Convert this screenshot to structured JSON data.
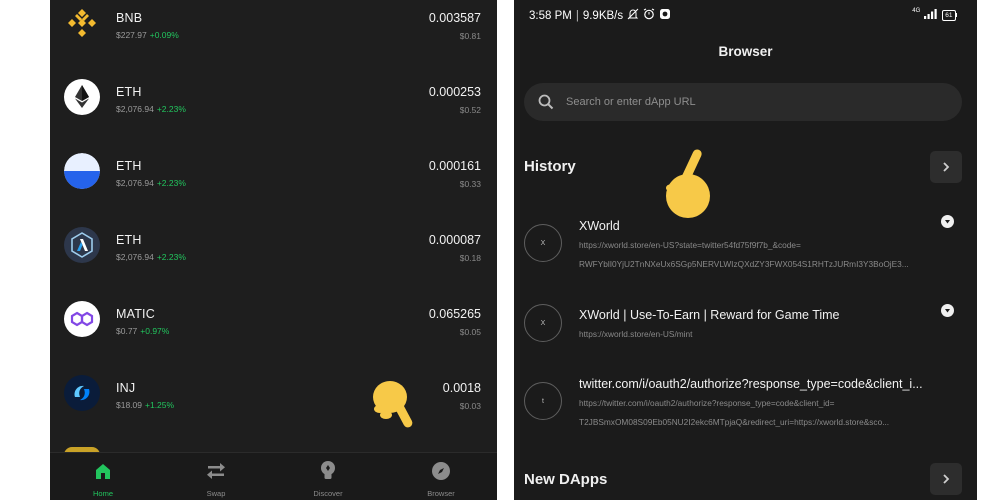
{
  "wallet": {
    "tokens": [
      {
        "symbol": "BNB",
        "price": "$227.97",
        "change": "+0.09%",
        "amount": "0.003587",
        "usd": "$0.81",
        "icon": "bnb-icon",
        "color": "#f3ba2f"
      },
      {
        "symbol": "ETH",
        "price": "$2,076.94",
        "change": "+2.23%",
        "amount": "0.000253",
        "usd": "$0.52",
        "icon": "ethereum-icon",
        "color": "#ffffff"
      },
      {
        "symbol": "ETH",
        "price": "$2,076.94",
        "change": "+2.23%",
        "amount": "0.000161",
        "usd": "$0.33",
        "icon": "base-icon",
        "color": "#2563eb"
      },
      {
        "symbol": "ETH",
        "price": "$2,076.94",
        "change": "+2.23%",
        "amount": "0.000087",
        "usd": "$0.18",
        "icon": "arbitrum-icon",
        "color": "#2d374b"
      },
      {
        "symbol": "MATIC",
        "price": "$0.77",
        "change": "+0.97%",
        "amount": "0.065265",
        "usd": "$0.05",
        "icon": "polygon-icon",
        "color": "#8247e5"
      },
      {
        "symbol": "INJ",
        "price": "$18.09",
        "change": "+1.25%",
        "amount": "0.0018",
        "usd": "$0.03",
        "icon": "injective-icon",
        "color": "#0082fa"
      }
    ],
    "nav": [
      {
        "label": "Home",
        "icon": "home-icon",
        "active": true
      },
      {
        "label": "Swap",
        "icon": "swap-icon",
        "active": false
      },
      {
        "label": "Discover",
        "icon": "lightbulb-icon",
        "active": false
      },
      {
        "label": "Browser",
        "icon": "compass-icon",
        "active": false
      }
    ]
  },
  "statusbar": {
    "time": "3:58 PM",
    "speed": "9.9KB/s",
    "network": "4G",
    "battery": "61"
  },
  "browser": {
    "title": "Browser",
    "search_placeholder": "Search or enter dApp URL",
    "history_title": "History",
    "new_dapps_title": "New DApps",
    "history": [
      {
        "badge": "X",
        "title": "XWorld",
        "line1": "https://xworld.store/en-US?state=twitter54fd75f9f7b_&code=",
        "line2": "RWFYblI0YjU2TnNXeUx6SGp5NERVLWIzQXdZY3FWX054S1RHTzJURmI3Y3BoOjE3..."
      },
      {
        "badge": "X",
        "title": "XWorld | Use-To-Earn | Reward for Game Time",
        "line1": "https://xworld.store/en-US/mint",
        "line2": ""
      },
      {
        "badge": "t",
        "title": "twitter.com/i/oauth2/authorize?response_type=code&client_i...",
        "line1": "https://twitter.com/i/oauth2/authorize?response_type=code&client_id=",
        "line2": "T2JBSmxOM08S09Eb05NU2I2ekc6MTpjaQ&redirect_uri=https://xworld.store&sco..."
      }
    ]
  }
}
